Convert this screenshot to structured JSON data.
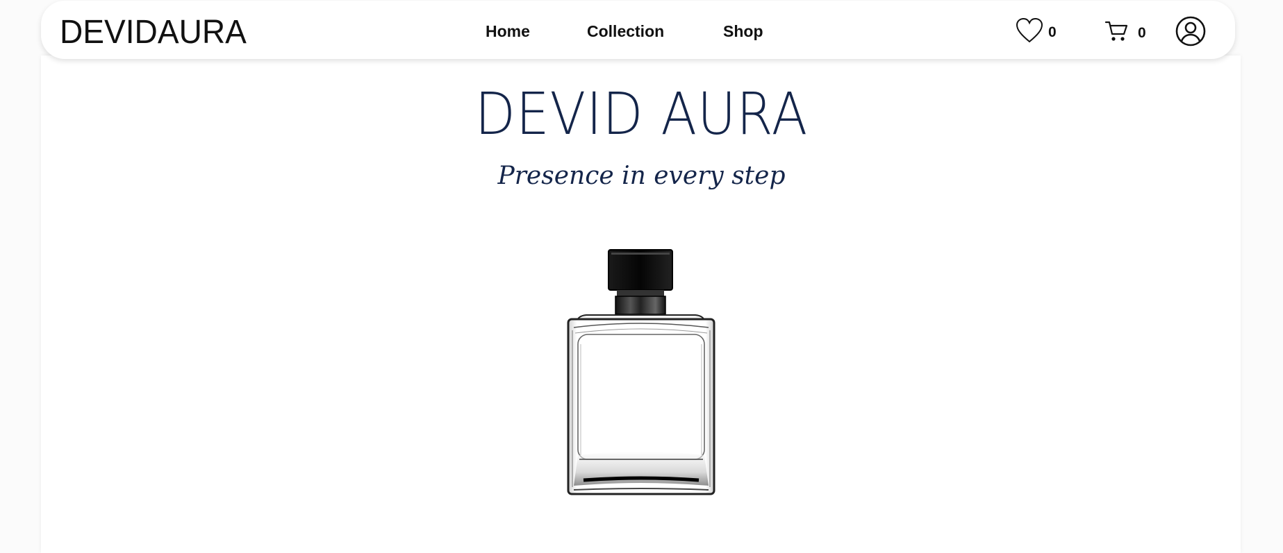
{
  "nav": {
    "logo": "DEVIDAURA",
    "links": [
      "Home",
      "Collection",
      "Shop"
    ],
    "wishlist_count": "0",
    "cart_count": "0",
    "icons": {
      "wishlist": "heart-icon",
      "cart": "cart-icon",
      "account": "user-circle-icon"
    }
  },
  "hero": {
    "title": "DEVID AURA",
    "subtitle": "Presence in every step",
    "image": "perfume-bottle-image"
  },
  "colors": {
    "title": "#14254a",
    "text": "#111111",
    "background": "#ffffff"
  }
}
